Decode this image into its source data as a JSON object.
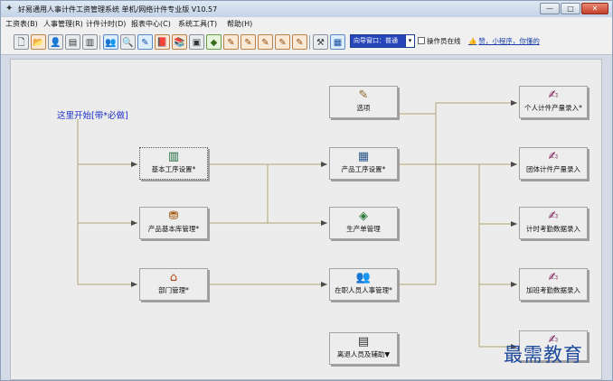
{
  "window": {
    "title": "好易通用人事计件工资管理系统 单机/网络计件专业版 V10.57",
    "minimize_glyph": "—",
    "maximize_glyph": "□",
    "close_glyph": "✕"
  },
  "menu": {
    "items": [
      {
        "label": "工资表(B)"
      },
      {
        "label": "人事管理(R)"
      },
      {
        "label": "计件计时(D)"
      },
      {
        "label": "报表中心(C)"
      },
      {
        "label": "系统工具(T)"
      },
      {
        "label": "帮助(H)"
      }
    ]
  },
  "toolbar": {
    "icons": [
      {
        "name": "new-file-icon",
        "glyph": "🗋"
      },
      {
        "name": "open-folder-icon",
        "glyph": "📂"
      },
      {
        "name": "user-icon",
        "glyph": "👤"
      },
      {
        "name": "card-icon",
        "glyph": "▤"
      },
      {
        "name": "binder-icon",
        "glyph": "▥"
      },
      {
        "name": "people-icon",
        "glyph": "👥"
      },
      {
        "name": "search-person-icon",
        "glyph": "🔍"
      },
      {
        "name": "edit-list-icon",
        "glyph": "✎"
      },
      {
        "name": "book-icon",
        "glyph": "📕"
      },
      {
        "name": "books-icon",
        "glyph": "📚"
      },
      {
        "name": "camera-icon",
        "glyph": "▣"
      },
      {
        "name": "diamond-icon",
        "glyph": "◆"
      },
      {
        "name": "edit-record-icon-1",
        "glyph": "✎"
      },
      {
        "name": "edit-record-icon-2",
        "glyph": "✎"
      },
      {
        "name": "edit-record-icon-3",
        "glyph": "✎"
      },
      {
        "name": "edit-record-icon-4",
        "glyph": "✎"
      },
      {
        "name": "edit-record-icon-5",
        "glyph": "✎"
      },
      {
        "name": "tools-icon",
        "glyph": "⚒"
      },
      {
        "name": "report-icon",
        "glyph": "▦"
      }
    ],
    "guide_label": "向导窗口：普通",
    "guide_arrow": "▾",
    "operator_online_label": "操作员在线",
    "mini_program_link": "赞，小程序，你懂的",
    "thumb_glyph": "👍"
  },
  "flow": {
    "start_label": "这里开始[带*必做]",
    "nodes": [
      {
        "id": "options",
        "label": "选项",
        "glyph": "✎",
        "color": "#8a6a2a"
      },
      {
        "id": "personal-piece",
        "label": "个人计件产量录入*",
        "glyph": "✍",
        "color": "#7a1a5a"
      },
      {
        "id": "basic-process",
        "label": "基本工序设置*",
        "glyph": "▥",
        "color": "#1d6a3d"
      },
      {
        "id": "product-process",
        "label": "产品工序设置*",
        "glyph": "▦",
        "color": "#2a5a8a"
      },
      {
        "id": "team-piece",
        "label": "团体计件产量录入",
        "glyph": "✍",
        "color": "#7a1a5a"
      },
      {
        "id": "product-base",
        "label": "产品基本库管理*",
        "glyph": "⛃",
        "color": "#a05a10"
      },
      {
        "id": "production-order",
        "label": "生产单管理",
        "glyph": "◈",
        "color": "#2e7a3a"
      },
      {
        "id": "hourly-attendance",
        "label": "计时考勤数据录入",
        "glyph": "✍",
        "color": "#7a1a5a"
      },
      {
        "id": "department",
        "label": "部门管理*",
        "glyph": "⌂",
        "color": "#b54512"
      },
      {
        "id": "staff-hr",
        "label": "在职人员人事管理*",
        "glyph": "👥",
        "color": "#6a2a8a"
      },
      {
        "id": "overtime-attendance",
        "label": "加班考勤数据录入",
        "glyph": "✍",
        "color": "#7a1a5a"
      },
      {
        "id": "resigned-staff",
        "label": "离退人员及辅助▼",
        "glyph": "▤",
        "color": "#333333"
      },
      {
        "id": "partial-edit",
        "label": "",
        "glyph": "✍",
        "color": "#7a1a5a"
      }
    ]
  },
  "watermark": "最需教育"
}
